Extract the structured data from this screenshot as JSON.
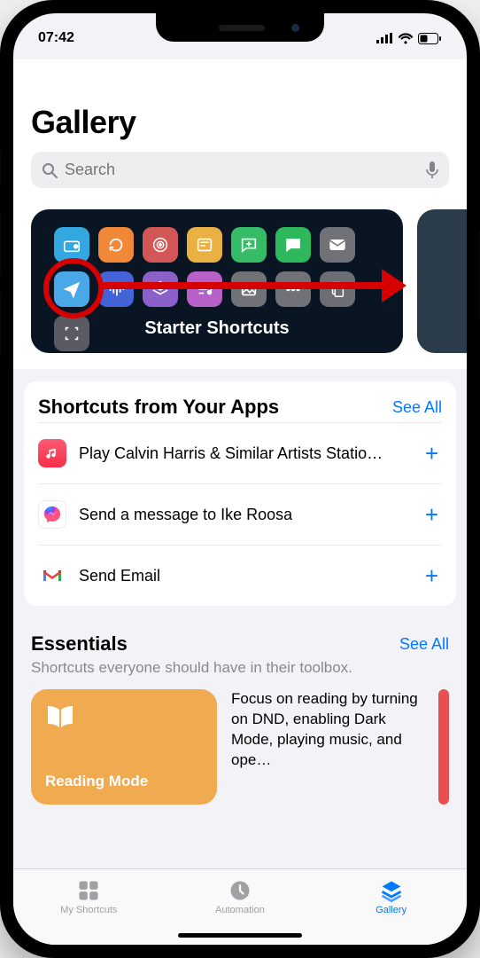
{
  "status": {
    "time": "07:42"
  },
  "header": {
    "title": "Gallery",
    "search_placeholder": "Search"
  },
  "featured": {
    "card_title": "Starter Shortcuts"
  },
  "shortcuts_section": {
    "title": "Shortcuts from Your Apps",
    "see_all": "See All",
    "items": [
      {
        "label": "Play Calvin Harris & Similar Artists Statio…"
      },
      {
        "label": "Send a message to Ike Roosa"
      },
      {
        "label": "Send Email"
      }
    ]
  },
  "essentials": {
    "title": "Essentials",
    "see_all": "See All",
    "subtitle": "Shortcuts everyone should have in their toolbox.",
    "card_title": "Reading Mode",
    "card_desc": "Focus on reading by turning on DND, enabling Dark Mode, playing music, and ope…"
  },
  "tabs": {
    "my_shortcuts": "My Shortcuts",
    "automation": "Automation",
    "gallery": "Gallery"
  }
}
